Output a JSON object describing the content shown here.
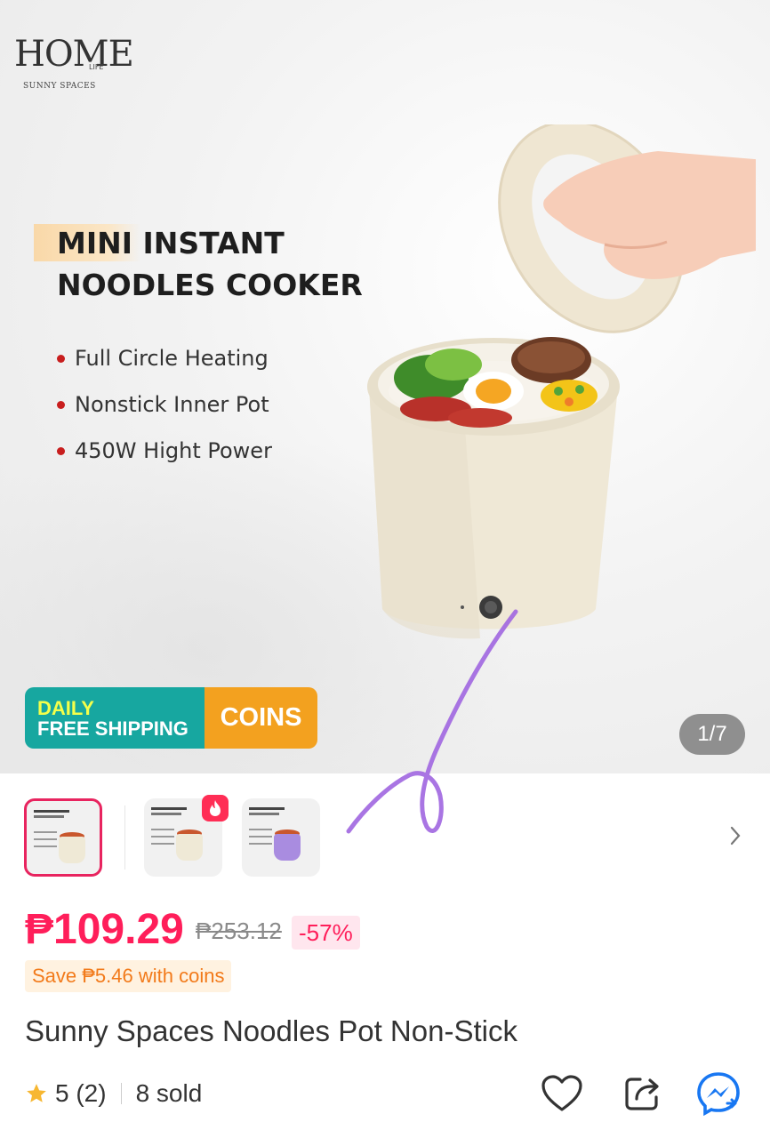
{
  "hero": {
    "brand_logo": "HOME",
    "brand_logo_sub": "LIFE",
    "brand_tagline": "SUNNY SPACES",
    "title_line1": "MINI INSTANT",
    "title_line2": "NOODLES COOKER",
    "features": [
      "Full Circle Heating",
      "Nonstick Inner Pot",
      "450W Hight Power"
    ],
    "shipping_badge": {
      "line1": "DAILY",
      "line2": "FREE SHIPPING",
      "coins": "COINS"
    },
    "image_counter": "1/7"
  },
  "thumbnails": {
    "count_visible": 3,
    "active_index": 0,
    "hot_icon": "fire-icon",
    "next_icon": "chevron-right-icon"
  },
  "pricing": {
    "current_price": "₱109.29",
    "original_price": "₱253.12",
    "discount": "-57%",
    "coin_savings": "Save ₱5.46 with coins"
  },
  "product": {
    "title": "Sunny Spaces Noodles Pot Non-Stick",
    "rating": "5 (2)",
    "sold": "8 sold",
    "rating_value": 5
  },
  "actions": {
    "favorite_icon": "heart-icon",
    "share_icon": "share-icon",
    "messenger_icon": "messenger-icon"
  },
  "colors": {
    "accent_pink": "#ff1e5a",
    "coin_orange": "#f27a1a",
    "badge_teal": "#17a7a0",
    "badge_orange": "#f3a11f",
    "messenger_blue": "#1877f2"
  }
}
